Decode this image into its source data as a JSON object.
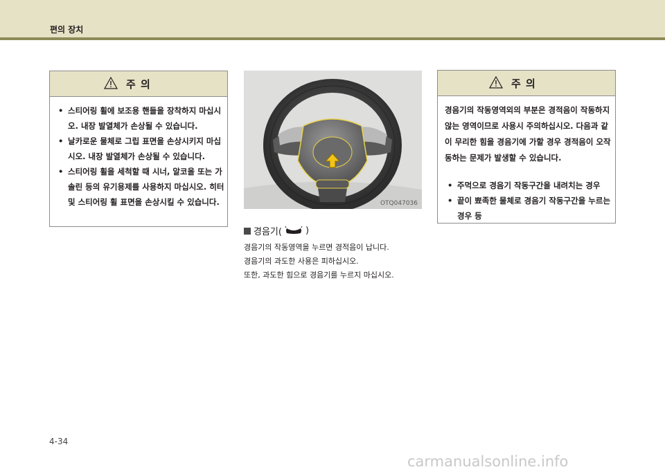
{
  "header": {
    "title": "편의 장치"
  },
  "caution_left": {
    "title": "주     의",
    "bullets": [
      "스티어링 휠에 보조용 핸들을 장착하지 마십시오. 내장 발열체가 손상될 수 있습니다.",
      "날카로운 물체로 그립 표면을 손상시키지 마십시오. 내장 발열체가 손상될 수 있습니다.",
      "스티어링 휠을 세척할 때 시너, 알코올 또는 가솔린 등의 유기용제를 사용하지 마십시오. 히터 및 스티어링 휠 표면을 손상시킬 수 있습니다."
    ]
  },
  "figure": {
    "code": "OTQ047036"
  },
  "section": {
    "title_prefix": "경음기(",
    "title_suffix": ")",
    "lines": [
      "경음기의 작동영역을 누르면 경적음이 납니다.",
      "경음기의 과도한 사용은 피하십시오.",
      "또한, 과도한 힘으로 경음기를 누르지 마십시오."
    ]
  },
  "caution_right": {
    "title": "주     의",
    "paragraph": "경음기의 작동영역외의 부분은 경적음이 작동하지 않는 영역이므로 사용시 주의하십시오. 다음과 같이 무리한 힘을 경음기에 가할 경우 경적음이 오작동하는 문제가 발생할 수 있습니다.",
    "bullets": [
      "주먹으로 경음기 작동구간을 내려치는 경우",
      "끝이 뾰족한 물체로 경음기 작동구간을 누르는 경우 등"
    ]
  },
  "footer": {
    "page_number": "4-34",
    "watermark": "carmanualsonline.info"
  }
}
